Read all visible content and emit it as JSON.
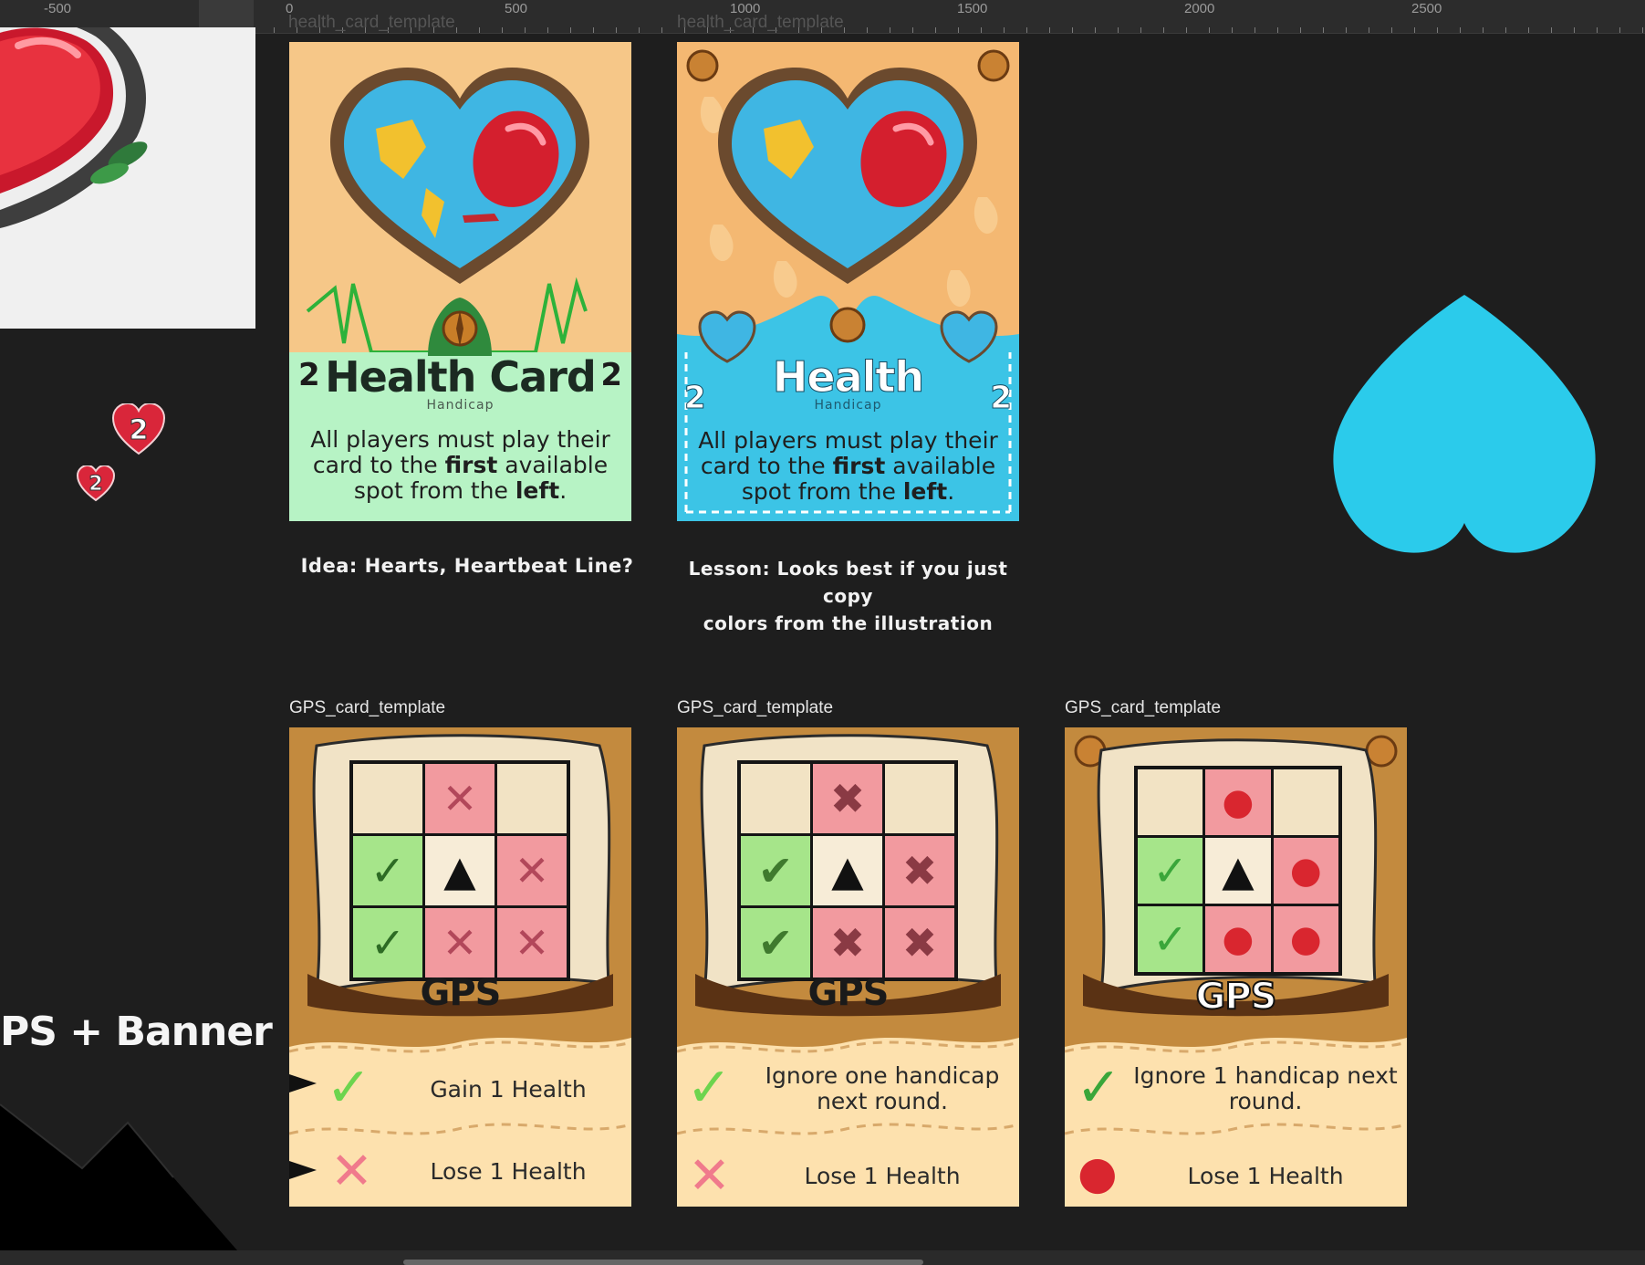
{
  "ruler": {
    "labels": [
      "-500",
      "0",
      "500",
      "1000",
      "1500",
      "2000",
      "2500"
    ]
  },
  "frames": {
    "health_1": "health_card_template",
    "health_2": "health_card_template",
    "gps_1": "GPS_card_template",
    "gps_2": "GPS_card_template",
    "gps_3": "GPS_card_template"
  },
  "health_card_a": {
    "title": "Health Card",
    "subtitle": "Handicap",
    "number": "2",
    "body_line1": "All players must play their",
    "body_line2_pre": "card to the ",
    "body_line2_bold": "first",
    "body_line2_post": " available",
    "body_line3_pre": "spot from the ",
    "body_line3_bold": "left",
    "body_line3_post": ".",
    "colors": {
      "bg": "#f6c788",
      "panel": "#b7f3c5",
      "line": "#2db23a"
    }
  },
  "health_card_b": {
    "title": "Health",
    "subtitle": "Handicap",
    "number": "2",
    "body_line1": "All players must play their",
    "body_line2_pre": "card to the ",
    "body_line2_bold": "first",
    "body_line2_post": " available",
    "body_line3_pre": "spot from the ",
    "body_line3_bold": "left",
    "body_line3_post": ".",
    "colors": {
      "bg": "#f4b872",
      "panel": "#3cc4e6"
    }
  },
  "notes": {
    "idea": "Idea: Hearts, Heartbeat Line?",
    "lesson_line1": "Lesson: Looks best if you just copy",
    "lesson_line2": "colors from the illustration"
  },
  "side_text": "PS + Banner",
  "small_hearts": [
    "2",
    "2"
  ],
  "gps_cards": [
    {
      "title": "GPS",
      "row1": "Gain 1 Health",
      "row2": "Lose 1 Health",
      "style": "outline"
    },
    {
      "title": "GPS",
      "row1_line1": "Ignore one handicap",
      "row1_line2": "next round.",
      "row2": "Lose 1 Health",
      "style": "solid"
    },
    {
      "title": "GPS",
      "row1_line1": "Ignore 1 handicap next",
      "row1_line2": "round.",
      "row2": "Lose 1 Health",
      "style": "bomb"
    }
  ],
  "colors": {
    "canvas": "#1e1e1e",
    "big_heart": "#2bcbeb",
    "heart_red": "#d9263a"
  },
  "icons": [
    "heart-world-illustration",
    "compass-icon",
    "check-icon",
    "cross-icon",
    "arrow-up-icon",
    "bomb-icon",
    "big-heart-shape"
  ]
}
